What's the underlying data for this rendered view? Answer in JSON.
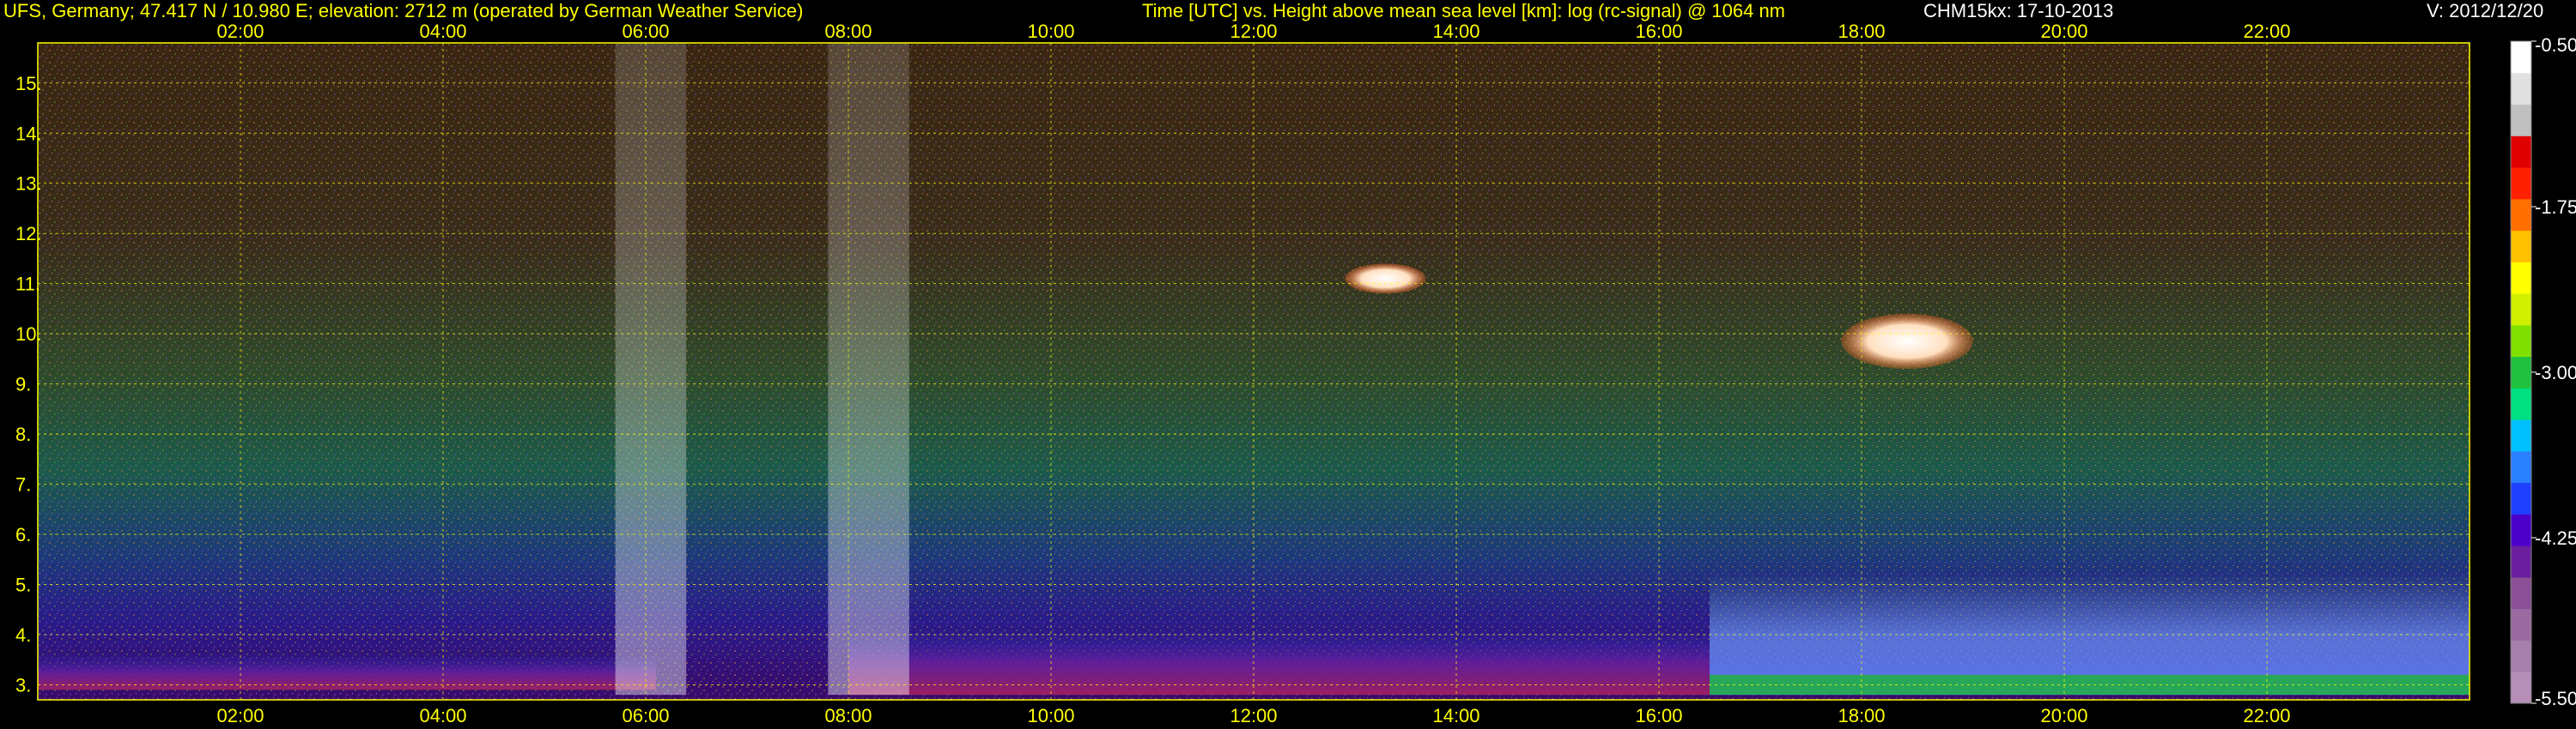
{
  "header": {
    "station": "UFS, Germany; 47.417 N / 10.980 E; elevation: 2712 m  (operated by German Weather Service)",
    "description": "Time [UTC] vs. Height above mean sea level [km]: log (rc-signal) @ 1064 nm",
    "device": "CHM15kx: 17-10-2013",
    "version": "V: 2012/12/20"
  },
  "chart_data": {
    "type": "heatmap",
    "title": "Time [UTC] vs. Height above mean sea level [km]: log (rc-signal) @ 1064 nm",
    "xlabel": "Time [UTC]",
    "ylabel": "Height above mean sea level [km]",
    "x_ticks": [
      "02:00",
      "04:00",
      "06:00",
      "08:00",
      "10:00",
      "12:00",
      "14:00",
      "16:00",
      "18:00",
      "20:00",
      "22:00"
    ],
    "y_ticks": [
      "3.",
      "4.",
      "5.",
      "6.",
      "7.",
      "8.",
      "9.",
      "10.",
      "11.",
      "12.",
      "13.",
      "14.",
      "15."
    ],
    "xlim_hours": [
      0.0,
      24.0
    ],
    "ylim_km": [
      2.7,
      15.8
    ],
    "grid": true,
    "colorbar": {
      "label_values": [
        -0.5,
        -1.75,
        -3.0,
        -4.25,
        -5.5
      ],
      "labels": [
        "-0.50",
        "-1.75",
        "-3.00",
        "-4.25",
        "-5.50"
      ],
      "range": [
        -5.5,
        -0.5
      ],
      "colors": [
        "#b58fb8",
        "#a880ac",
        "#9a6ba0",
        "#8a4f95",
        "#6a1f9f",
        "#4b00c8",
        "#1f3fff",
        "#2a7fff",
        "#00c0ff",
        "#00e080",
        "#20c040",
        "#80e000",
        "#d0f000",
        "#ffff00",
        "#ffc000",
        "#ff7000",
        "#ff2000",
        "#e00000",
        "#c0c0c0",
        "#e0e0e0",
        "#ffffff"
      ]
    },
    "features": [
      {
        "kind": "aerosol-layer",
        "t_start": 0.0,
        "t_end": 6.1,
        "h_bottom": 2.9,
        "h_top": 3.6,
        "value": -2.6
      },
      {
        "kind": "aerosol-layer",
        "t_start": 8.0,
        "t_end": 16.5,
        "h_bottom": 2.8,
        "h_top": 4.1,
        "value": -3.2
      },
      {
        "kind": "boundary-layer",
        "t_start": 16.5,
        "t_end": 24.0,
        "h_bottom": 2.8,
        "h_top": 5.2,
        "value": -3.6
      },
      {
        "kind": "surface-layer",
        "t_start": 16.5,
        "t_end": 24.0,
        "h_bottom": 2.8,
        "h_top": 3.2,
        "value": -1.9
      },
      {
        "kind": "cirrus-cloud",
        "t_start": 17.8,
        "t_end": 19.1,
        "h_bottom": 9.3,
        "h_top": 10.4,
        "value": -0.6
      },
      {
        "kind": "cirrus-cloud",
        "t_start": 12.9,
        "t_end": 13.7,
        "h_bottom": 10.8,
        "h_top": 11.4,
        "value": -1.0
      },
      {
        "kind": "precipitation-streak",
        "t_start": 5.7,
        "t_end": 6.4,
        "h_bottom": 2.8,
        "h_top": 15.8,
        "value": -0.8
      },
      {
        "kind": "precipitation-streak",
        "t_start": 7.8,
        "t_end": 8.6,
        "h_bottom": 2.8,
        "h_top": 15.8,
        "value": -1.0
      }
    ]
  }
}
